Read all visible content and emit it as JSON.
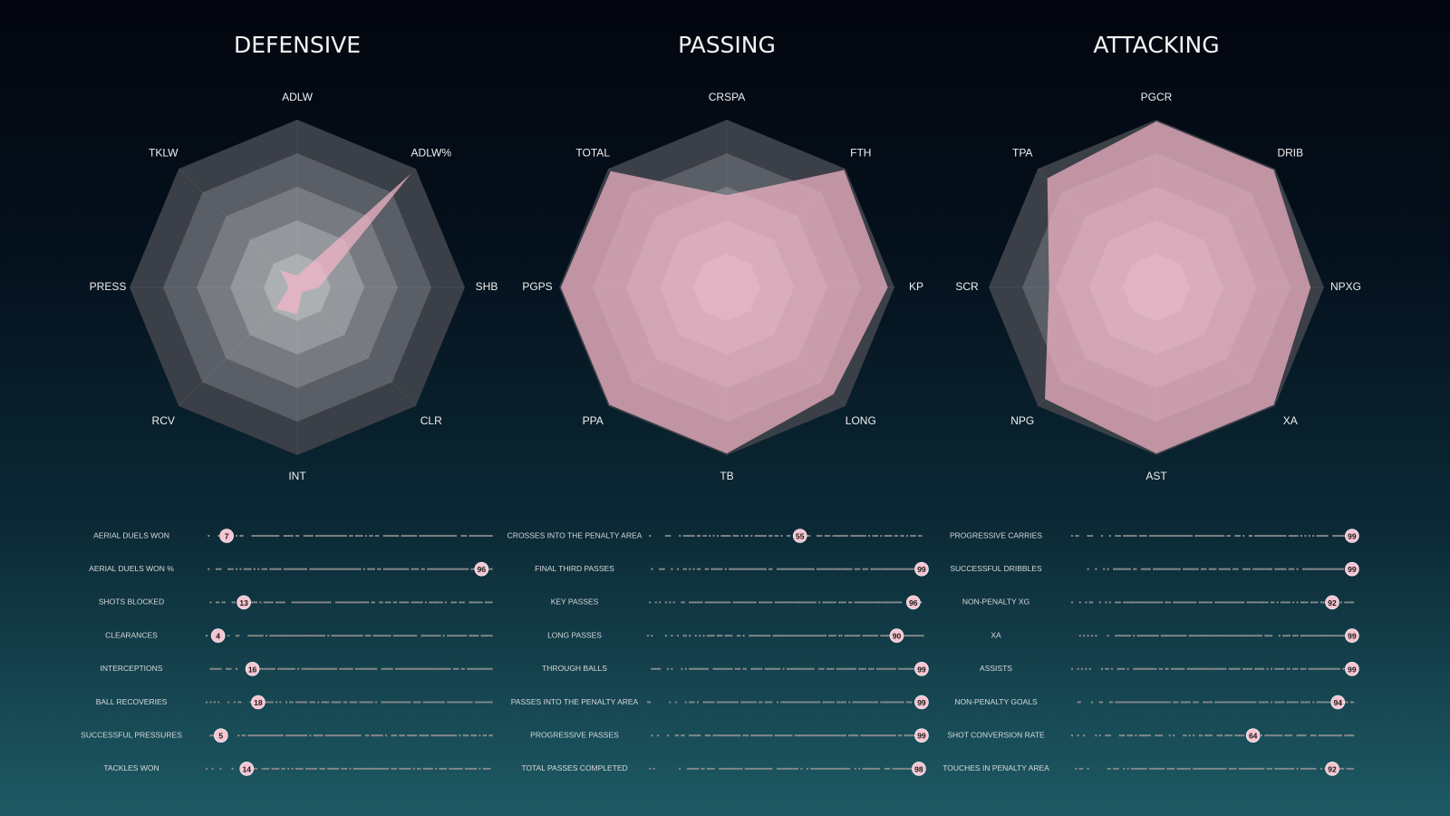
{
  "colors": {
    "player_fill": "#f4b6c8",
    "dots": "#8c8c8c",
    "badge": "#f7c5d2",
    "rings": [
      "#3b3f47",
      "#5a5e66",
      "#777a80",
      "#94979b",
      "#adb0b3"
    ]
  },
  "chart_data": [
    {
      "type": "radar",
      "title": "DEFENSIVE",
      "scale": [
        0,
        100
      ],
      "axes": [
        "ADLW",
        "ADLW%",
        "SHB",
        "CLR",
        "INT",
        "RCV",
        "PRESS",
        "TKLW"
      ],
      "values": [
        7,
        96,
        13,
        4,
        16,
        18,
        5,
        14
      ]
    },
    {
      "type": "radar",
      "title": "PASSING",
      "scale": [
        0,
        100
      ],
      "axes": [
        "CRSPA",
        "FTH",
        "KP",
        "LONG",
        "TB",
        "PPA",
        "PGPS",
        "TOTAL"
      ],
      "values": [
        55,
        99,
        96,
        90,
        99,
        99,
        99,
        98
      ]
    },
    {
      "type": "radar",
      "title": "ATTACKING",
      "scale": [
        0,
        100
      ],
      "axes": [
        "PGCR",
        "DRIB",
        "NPXG",
        "XA",
        "AST",
        "NPG",
        "SCR",
        "TPA"
      ],
      "values": [
        99,
        99,
        92,
        99,
        99,
        94,
        64,
        92
      ]
    },
    {
      "type": "percentile_strip",
      "metrics": [
        {
          "label": "AERIAL DUELS WON",
          "value": 7
        },
        {
          "label": "AERIAL DUELS WON %",
          "value": 96
        },
        {
          "label": "SHOTS BLOCKED",
          "value": 13
        },
        {
          "label": "CLEARANCES",
          "value": 4
        },
        {
          "label": "INTERCEPTIONS",
          "value": 16
        },
        {
          "label": "BALL RECOVERIES",
          "value": 18
        },
        {
          "label": "SUCCESSFUL PRESSURES",
          "value": 5
        },
        {
          "label": "TACKLES WON",
          "value": 14
        }
      ]
    },
    {
      "type": "percentile_strip",
      "metrics": [
        {
          "label": "CROSSES INTO THE PENALTY AREA",
          "value": 55
        },
        {
          "label": "FINAL THIRD PASSES",
          "value": 99
        },
        {
          "label": "KEY PASSES",
          "value": 96
        },
        {
          "label": "LONG PASSES",
          "value": 90
        },
        {
          "label": "THROUGH BALLS",
          "value": 99
        },
        {
          "label": "PASSES INTO THE PENALTY AREA",
          "value": 99
        },
        {
          "label": "PROGRESSIVE PASSES",
          "value": 99
        },
        {
          "label": "TOTAL PASSES COMPLETED",
          "value": 98
        }
      ]
    },
    {
      "type": "percentile_strip",
      "metrics": [
        {
          "label": "PROGRESSIVE CARRIES",
          "value": 99
        },
        {
          "label": "SUCCESSFUL DRIBBLES",
          "value": 99
        },
        {
          "label": "NON-PENALTY XG",
          "value": 92
        },
        {
          "label": "XA",
          "value": 99
        },
        {
          "label": "ASSISTS",
          "value": 99
        },
        {
          "label": "NON-PENALTY GOALS",
          "value": 94
        },
        {
          "label": "SHOT CONVERSION RATE",
          "value": 64
        },
        {
          "label": "TOUCHES IN PENALTY AREA",
          "value": 92
        }
      ]
    }
  ]
}
